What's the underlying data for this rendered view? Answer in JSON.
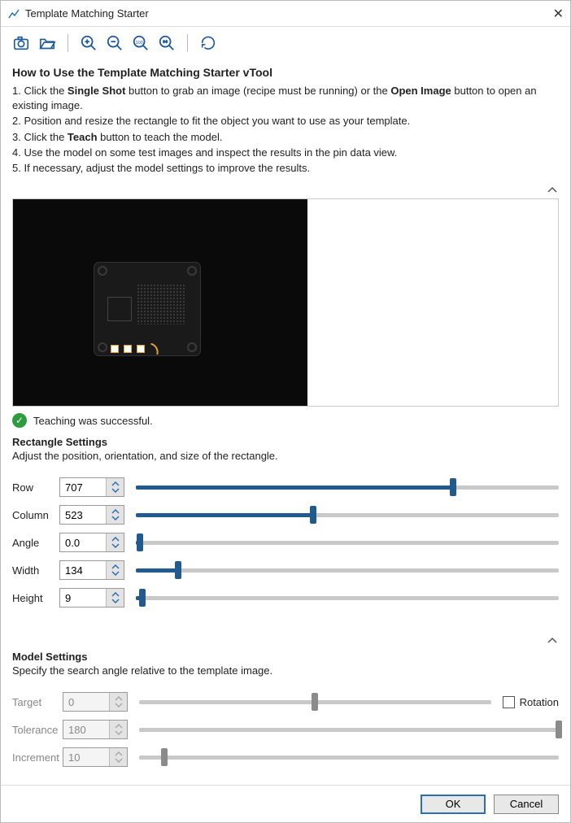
{
  "window": {
    "title": "Template Matching Starter"
  },
  "howto": {
    "heading": "How to Use the Template Matching Starter vTool",
    "line1a": "1. Click the ",
    "line1b": "Single Shot",
    "line1c": " button to grab an image (recipe must be running) or the ",
    "line1d": "Open Image",
    "line1e": " button to open an existing image.",
    "line2": "2. Position and resize the rectangle to fit the object you want to use as your template.",
    "line3a": "3. Click the ",
    "line3b": "Teach",
    "line3c": " button to teach the model.",
    "line4": "4. Use the model on some test images and inspect the results in the pin data view.",
    "line5": "5. If necessary, adjust the model settings to improve the results."
  },
  "status": {
    "text": "Teaching was successful."
  },
  "rect": {
    "heading": "Rectangle Settings",
    "desc": "Adjust the position, orientation, and size of the rectangle.",
    "rowLabel": "Row",
    "rowValue": "707",
    "rowPct": 75,
    "colLabel": "Column",
    "colValue": "523",
    "colPct": 42,
    "angLabel": "Angle",
    "angValue": "0.0",
    "angPct": 1,
    "widLabel": "Width",
    "widValue": "134",
    "widPct": 10,
    "heiLabel": "Height",
    "heiValue": "9",
    "heiPct": 1.5
  },
  "model": {
    "heading": "Model Settings",
    "desc": "Specify the search angle relative to the template image.",
    "tgtLabel": "Target",
    "tgtValue": "0",
    "tgtPct": 50,
    "tolLabel": "Tolerance",
    "tolValue": "180",
    "tolPct": 100,
    "incLabel": "Increment",
    "incValue": "10",
    "incPct": 6,
    "rotationLabel": "Rotation"
  },
  "footer": {
    "ok": "OK",
    "cancel": "Cancel"
  }
}
